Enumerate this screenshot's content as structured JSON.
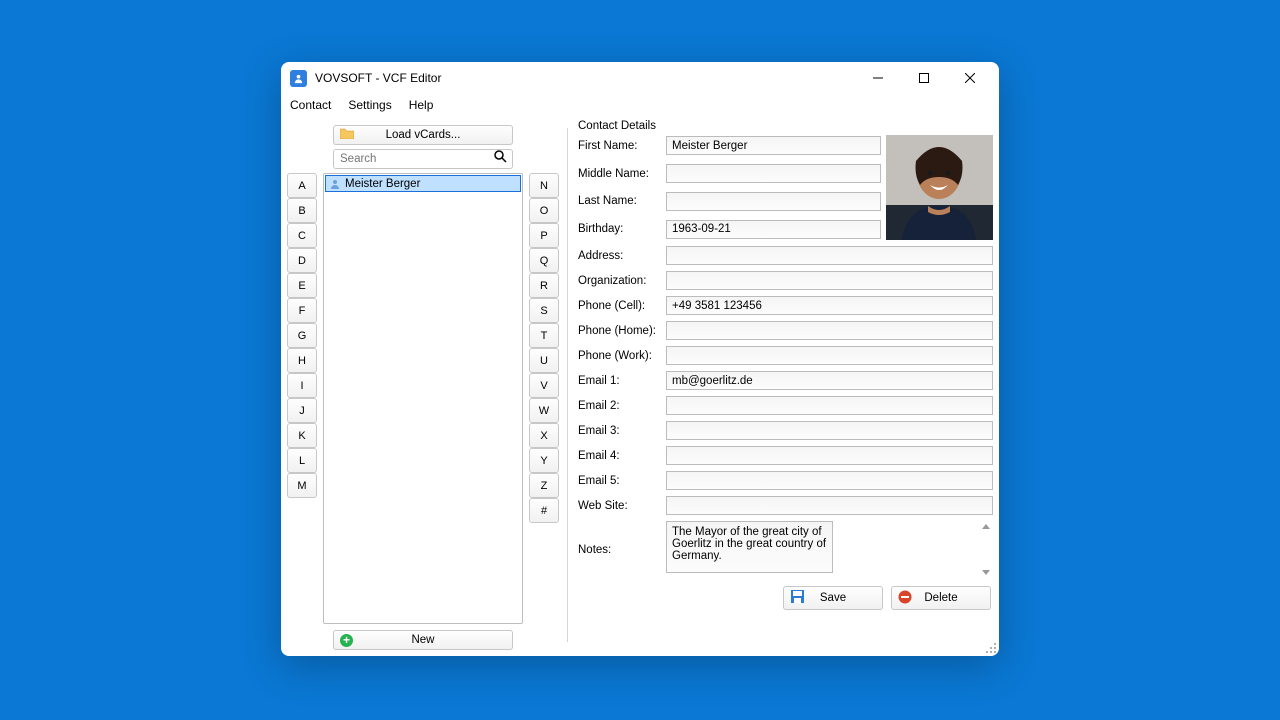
{
  "window": {
    "title": "VOVSOFT - VCF Editor"
  },
  "menubar": [
    "Contact",
    "Settings",
    "Help"
  ],
  "left": {
    "load_label": "Load vCards...",
    "search_placeholder": "Search",
    "new_label": "New",
    "az_left": [
      "A",
      "B",
      "C",
      "D",
      "E",
      "F",
      "G",
      "H",
      "I",
      "J",
      "K",
      "L",
      "M"
    ],
    "az_right": [
      "N",
      "O",
      "P",
      "Q",
      "R",
      "S",
      "T",
      "U",
      "V",
      "W",
      "X",
      "Y",
      "Z",
      "#"
    ],
    "items": [
      {
        "name": "Meister Berger"
      }
    ]
  },
  "details": {
    "heading": "Contact Details",
    "labels": {
      "first_name": "First Name:",
      "middle_name": "Middle Name:",
      "last_name": "Last Name:",
      "birthday": "Birthday:",
      "address": "Address:",
      "organization": "Organization:",
      "phone_cell": "Phone (Cell):",
      "phone_home": "Phone (Home):",
      "phone_work": "Phone (Work):",
      "email1": "Email 1:",
      "email2": "Email 2:",
      "email3": "Email 3:",
      "email4": "Email 4:",
      "email5": "Email 5:",
      "website": "Web Site:",
      "notes": "Notes:"
    },
    "values": {
      "first_name": "Meister Berger",
      "middle_name": "",
      "last_name": "",
      "birthday": "1963-09-21",
      "address": "",
      "organization": "",
      "phone_cell": "+49 3581 123456",
      "phone_home": "",
      "phone_work": "",
      "email1": "mb@goerlitz.de",
      "email2": "",
      "email3": "",
      "email4": "",
      "email5": "",
      "website": "",
      "notes": "The Mayor of the great city of\nGoerlitz in the great country of Germany."
    },
    "save_label": "Save",
    "delete_label": "Delete"
  }
}
